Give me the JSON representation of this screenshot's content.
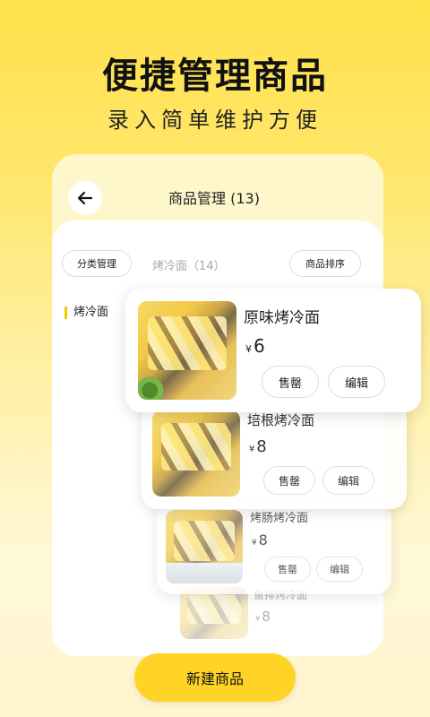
{
  "hero": {
    "title": "便捷管理商品",
    "subtitle": "录入简单维护方便"
  },
  "header": {
    "title": "商品管理 (13)"
  },
  "toolbar": {
    "category_button": "分类管理",
    "current_tab": "烤冷面（14）",
    "sort_button": "商品排序"
  },
  "sidebar": {
    "items": [
      {
        "label": "烤冷面"
      }
    ]
  },
  "products": [
    {
      "name": "原味烤冷面",
      "currency": "¥",
      "price": "6",
      "sold_out_label": "售罄",
      "edit_label": "编辑"
    },
    {
      "name": "培根烤冷面",
      "currency": "¥",
      "price": "8",
      "sold_out_label": "售罄",
      "edit_label": "编辑"
    },
    {
      "name": "烤肠烤冷面",
      "currency": "¥",
      "price": "8",
      "sold_out_label": "售罄",
      "edit_label": "编辑"
    },
    {
      "name": "鱼排烤冷面",
      "currency": "¥",
      "price": "8"
    }
  ],
  "footer": {
    "new_button": "新建商品"
  },
  "colors": {
    "accent": "#ffd426",
    "background_top": "#ffe14a",
    "indicator": "#f6c800"
  },
  "icons": {
    "back": "arrow-left-icon"
  }
}
